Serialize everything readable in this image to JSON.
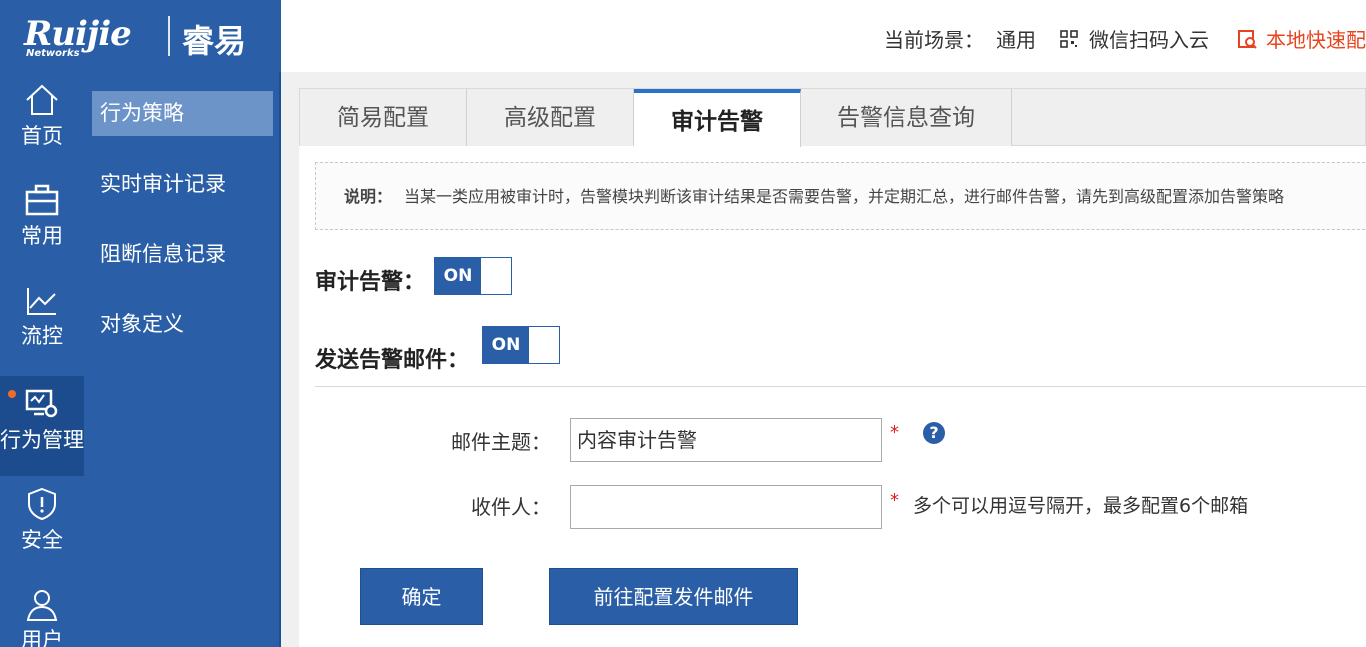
{
  "brand": {
    "logo_text": "Ruijie",
    "logo_sub": "Networks",
    "product": "睿易"
  },
  "header": {
    "scene_label": "当前场景：",
    "scene_value": "通用",
    "wechat_label": "微信扫码入云",
    "local_label": "本地快速配",
    "accent_color": "#e8431e"
  },
  "nav": {
    "items": [
      {
        "label": "首页",
        "icon": "home-icon"
      },
      {
        "label": "常用",
        "icon": "briefcase-icon"
      },
      {
        "label": "流控",
        "icon": "chart-line-icon"
      },
      {
        "label": "行为管理",
        "icon": "monitor-gear-icon",
        "active": true
      },
      {
        "label": "安全",
        "icon": "shield-icon"
      },
      {
        "label": "用户",
        "icon": "user-icon"
      }
    ]
  },
  "submenu": {
    "items": [
      {
        "label": "行为策略",
        "active": true
      },
      {
        "label": "实时审计记录"
      },
      {
        "label": "阻断信息记录"
      },
      {
        "label": "对象定义"
      }
    ]
  },
  "tabs": [
    {
      "label": "简易配置"
    },
    {
      "label": "高级配置"
    },
    {
      "label": "审计告警",
      "active": true
    },
    {
      "label": "告警信息查询"
    }
  ],
  "note": {
    "prefix": "说明：",
    "text": "当某一类应用被审计时，告警模块判断该审计结果是否需要告警，并定期汇总，进行邮件告警，请先到高级配置添加告警策略"
  },
  "audit_alarm": {
    "label": "审计告警：",
    "toggle": "ON"
  },
  "send_mail": {
    "label": "发送告警邮件：",
    "toggle": "ON"
  },
  "form": {
    "subject_label": "邮件主题：",
    "subject_value": "内容审计告警",
    "recipient_label": "收件人：",
    "recipient_value": "",
    "recipient_hint": "多个可以用逗号隔开，最多配置6个邮箱",
    "required_mark": "*",
    "help_mark": "?"
  },
  "buttons": {
    "confirm": "确定",
    "goto_mail": "前往配置发件邮件"
  },
  "colors": {
    "primary": "#2a5fa8",
    "active_tab_border": "#2a72c9",
    "required": "#e02020"
  }
}
